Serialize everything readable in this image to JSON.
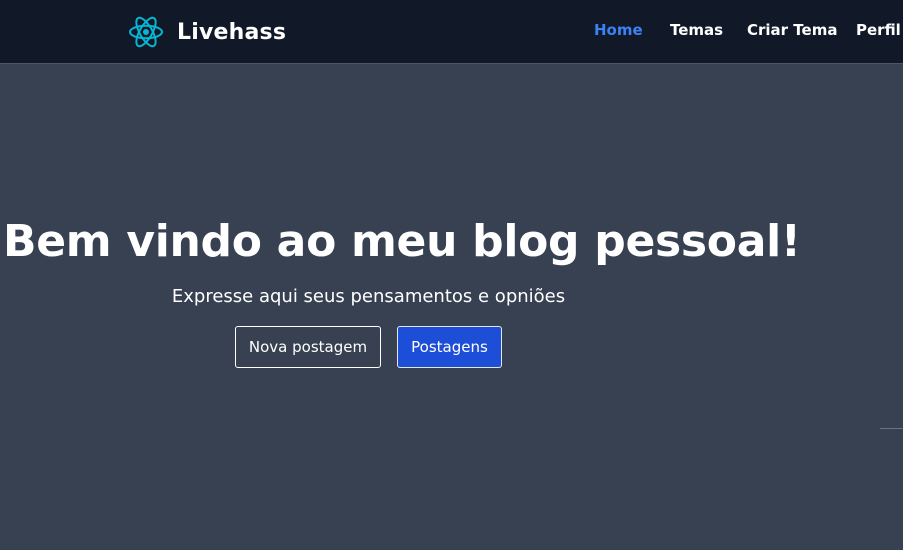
{
  "navbar": {
    "brand_name": "Livehass",
    "logo_icon": "react-atom-icon",
    "links": [
      {
        "label": "Home",
        "active": true
      },
      {
        "label": "Temas",
        "active": false
      },
      {
        "label": "Criar Tema",
        "active": false
      },
      {
        "label": "Perfil",
        "active": false
      }
    ]
  },
  "hero": {
    "title": "Bem vindo ao meu blog pessoal!",
    "subtitle": "Expresse aqui seus pensamentos e opniões",
    "buttons": {
      "new_post": "Nova postagem",
      "posts": "Postagens"
    }
  },
  "colors": {
    "navbar_bg": "#111827",
    "page_bg": "#374151",
    "accent": "#3b82f6",
    "primary_button": "#1d4ed8",
    "logo": "#06b6d4"
  }
}
